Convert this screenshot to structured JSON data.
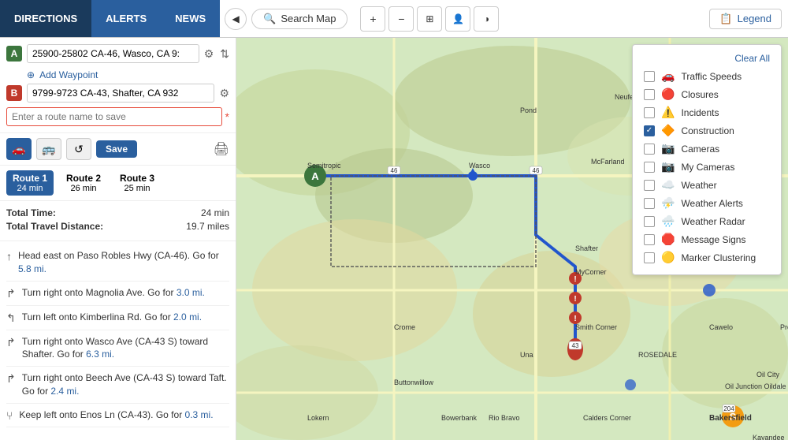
{
  "tabs": {
    "directions": "DIRECTIONS",
    "alerts": "ALERTS",
    "news": "NEWS"
  },
  "toolbar": {
    "search_map": "Search Map",
    "legend": "Legend",
    "clear_all": "Clear All"
  },
  "directions": {
    "origin": "25900-25802 CA-46, Wasco, CA 9:",
    "destination": "9799-9723 CA-43, Shafter, CA 932",
    "add_waypoint": "Add Waypoint",
    "route_name_placeholder": "Enter a route name to save",
    "save": "Save",
    "total_time_label": "Total Time:",
    "total_time_value": "24 min",
    "total_distance_label": "Total Travel Distance:",
    "total_distance_value": "19.7 miles",
    "routes": [
      {
        "name": "Route 1",
        "time": "24 min",
        "active": true
      },
      {
        "name": "Route 2",
        "time": "26 min",
        "active": false
      },
      {
        "name": "Route 3",
        "time": "25 min",
        "active": false
      }
    ],
    "steps": [
      {
        "icon": "↑",
        "text": "Head east on Paso Robles Hwy (CA-46). Go for 5.8 mi."
      },
      {
        "icon": "↱",
        "text": "Turn right onto Magnolia Ave. Go for 3.0 mi."
      },
      {
        "icon": "↰",
        "text": "Turn left onto Kimberlina Rd. Go for 2.0 mi."
      },
      {
        "icon": "↱",
        "text": "Turn right onto Wasco Ave (CA-43 S) toward Shafter. Go for 6.3 mi."
      },
      {
        "icon": "↱",
        "text": "Turn right onto Beech Ave (CA-43 S) toward Taft. Go for 2.4 mi."
      },
      {
        "icon": "↰",
        "text": "Keep left onto Enos Ln (CA-43). Go for 0.3 mi."
      }
    ],
    "step_links": [
      {
        "text": "5.8 mi."
      },
      {
        "text": "3.0 mi."
      },
      {
        "text": "2.0 mi."
      },
      {
        "text": "6.3 mi."
      },
      {
        "text": "2.4 mi."
      },
      {
        "text": "0.3 mi."
      }
    ]
  },
  "legend": {
    "items": [
      {
        "id": "traffic-speeds",
        "label": "Traffic Speeds",
        "icon": "🚗",
        "checked": false
      },
      {
        "id": "closures",
        "label": "Closures",
        "icon": "🔴",
        "checked": false
      },
      {
        "id": "incidents",
        "label": "Incidents",
        "icon": "⚠",
        "checked": false
      },
      {
        "id": "construction",
        "label": "Construction",
        "icon": "🔶",
        "checked": true
      },
      {
        "id": "cameras",
        "label": "Cameras",
        "icon": "📷",
        "checked": false
      },
      {
        "id": "my-cameras",
        "label": "My Cameras",
        "icon": "📷",
        "checked": false
      },
      {
        "id": "weather",
        "label": "Weather",
        "icon": "☁",
        "checked": false
      },
      {
        "id": "weather-alerts",
        "label": "Weather Alerts",
        "icon": "⛈",
        "checked": false
      },
      {
        "id": "weather-radar",
        "label": "Weather Radar",
        "icon": "🌧",
        "checked": false
      },
      {
        "id": "message-signs",
        "label": "Message Signs",
        "icon": "🛑",
        "checked": false
      },
      {
        "id": "marker-clustering",
        "label": "Marker Clustering",
        "icon": "🟡",
        "checked": false
      }
    ]
  },
  "icons": {
    "search": "🔍",
    "back": "◀",
    "plus": "+",
    "minus": "−",
    "layer": "⊞",
    "person": "👤",
    "contrast": "◑",
    "legend": "📋",
    "car": "🚗",
    "bus": "🚌",
    "refresh": "↺",
    "print": "🖨",
    "swap": "⇅",
    "gear": "⚙",
    "circle_plus": "⊕",
    "up_arrow": "↑",
    "right_arrow": "↱",
    "left_arrow": "↰",
    "fork_arrow": "⑂"
  },
  "map": {
    "route_color": "#2255cc",
    "construction_color": "#e74c3c"
  }
}
